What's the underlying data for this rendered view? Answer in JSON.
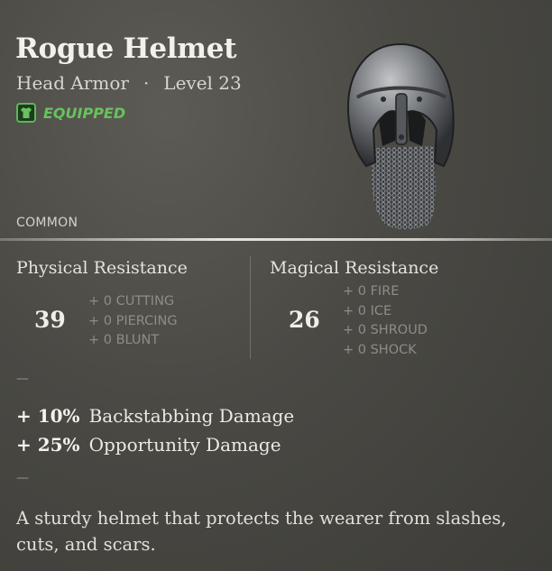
{
  "item": {
    "name": "Rogue Helmet",
    "type": "Head Armor",
    "separator": "·",
    "level": "Level 23",
    "status": "EQUIPPED",
    "rarity": "COMMON"
  },
  "physical": {
    "title": "Physical Resistance",
    "value": "39",
    "components": [
      "+ 0 CUTTING",
      "+ 0 PIERCING",
      "+ 0 BLUNT"
    ]
  },
  "magical": {
    "title": "Magical Resistance",
    "value": "26",
    "components": [
      "+ 0 FIRE",
      "+ 0 ICE",
      "+ 0 SHROUD",
      "+ 0 SHOCK"
    ]
  },
  "section_dash": "—",
  "bonuses": [
    {
      "percent": "+ 10%",
      "label": "Backstabbing Damage"
    },
    {
      "percent": "+ 25%",
      "label": "Opportunity Damage"
    }
  ],
  "description": "A sturdy helmet that protects the wearer from slashes, cuts, and scars.",
  "colors": {
    "equipped": "#67c35d",
    "background": "#4a4944",
    "muted_text": "#8f8c86"
  },
  "icons": {
    "equipped": "shirt-icon",
    "item": "helmet-icon"
  }
}
